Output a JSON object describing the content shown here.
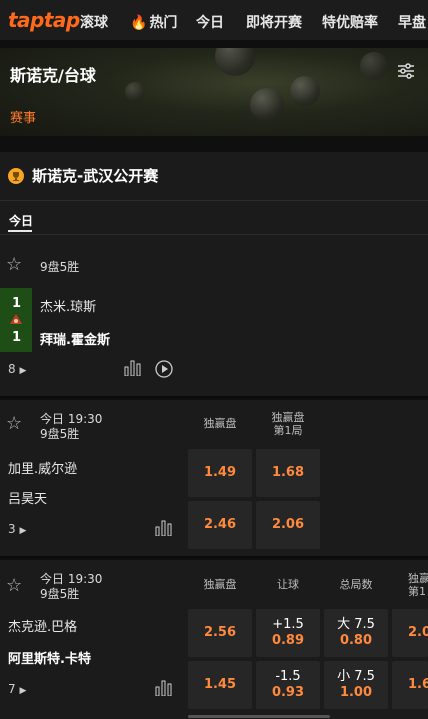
{
  "nav": {
    "logo": "taptap",
    "items": [
      {
        "label": "滚球"
      },
      {
        "label": "热门"
      },
      {
        "label": "今日"
      },
      {
        "label": "即将开赛"
      },
      {
        "label": "特优赔率"
      },
      {
        "label": "早盘"
      }
    ]
  },
  "banner": {
    "title": "斯诺克/台球",
    "tab": "赛事"
  },
  "competition": {
    "name": "斯诺克-武汉公开赛",
    "day_tab": "今日"
  },
  "match1": {
    "format": "9盘5胜",
    "team1": {
      "name": "杰米.琼斯",
      "score": "1"
    },
    "team2": {
      "name": "拜瑞.霍金斯",
      "score": "1"
    },
    "more_count": "8"
  },
  "match2": {
    "time": "今日 19:30",
    "format": "9盘5胜",
    "team1": "加里.威尔逊",
    "team2": "吕昊天",
    "more_count": "3",
    "col1": "独赢盘",
    "col2_line1": "独赢盘",
    "col2_line2": "第1局",
    "odds": {
      "r1c1": "1.49",
      "r1c2": "1.68",
      "r2c1": "2.46",
      "r2c2": "2.06"
    }
  },
  "match3": {
    "time": "今日 19:30",
    "format": "9盘5胜",
    "team1": "杰克逊.巴格",
    "team2": "阿里斯特.卡特",
    "more_count": "7",
    "col1": "独赢盘",
    "col2": "让球",
    "col3": "总局数",
    "col4_line1": "独赢",
    "col4_line2": "第1",
    "odds": {
      "r1c1": "2.56",
      "r1c2_label": "+1.5",
      "r1c2": "0.89",
      "r1c3_label": "大 7.5",
      "r1c3": "0.80",
      "r1c4": "2.0",
      "r2c1": "1.45",
      "r2c2_label": "-1.5",
      "r2c2": "0.93",
      "r2c3_label": "小 7.5",
      "r2c3": "1.00",
      "r2c4": "1.6"
    }
  },
  "colors": {
    "accent": "#ff7a2a",
    "background": "#1b1b1b",
    "live_green": "#1f4d16"
  }
}
